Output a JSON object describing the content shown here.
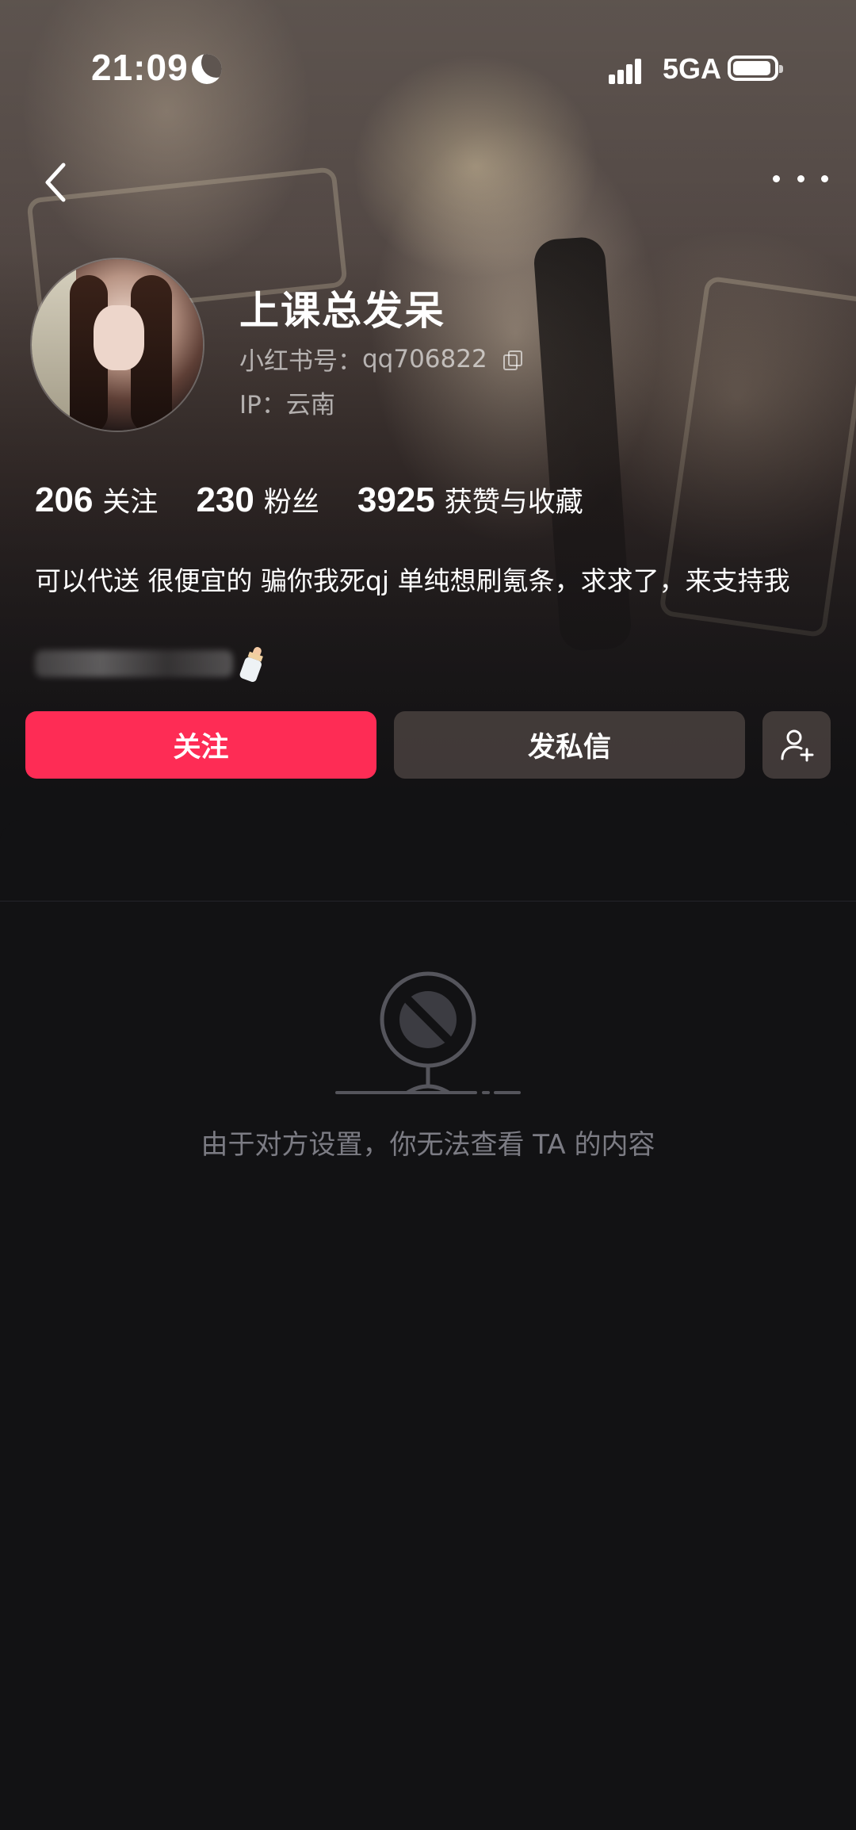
{
  "status_bar": {
    "time": "21:09",
    "network": "5GA",
    "icons": [
      "moon-icon",
      "signal-icon",
      "battery-icon"
    ]
  },
  "nav": {
    "back_icon": "chevron-left-icon",
    "more_icon": "ellipsis-icon"
  },
  "profile": {
    "username": "上课总发呆",
    "red_id_label": "小红书号：",
    "red_id_value": "qq706822",
    "ip_label": "IP：",
    "ip_value": "云南",
    "stats": [
      {
        "value": "206",
        "label": "关注"
      },
      {
        "value": "230",
        "label": "粉丝"
      },
      {
        "value": "3925",
        "label": "获赞与收藏"
      }
    ],
    "bio": "可以代送 很便宜的 骗你我死qj 单纯想刷氪条，求求了，来支持我"
  },
  "actions": {
    "follow_label": "关注",
    "message_label": "发私信",
    "add_friend_icon": "person-plus-icon"
  },
  "content": {
    "empty_icon": "blocked-icon",
    "empty_message": "由于对方设置，你无法查看 TA 的内容"
  },
  "colors": {
    "accent": "#fe2c55",
    "background": "#121214",
    "secondary_button": "#463e3c",
    "muted_text": "#7c7c84"
  }
}
